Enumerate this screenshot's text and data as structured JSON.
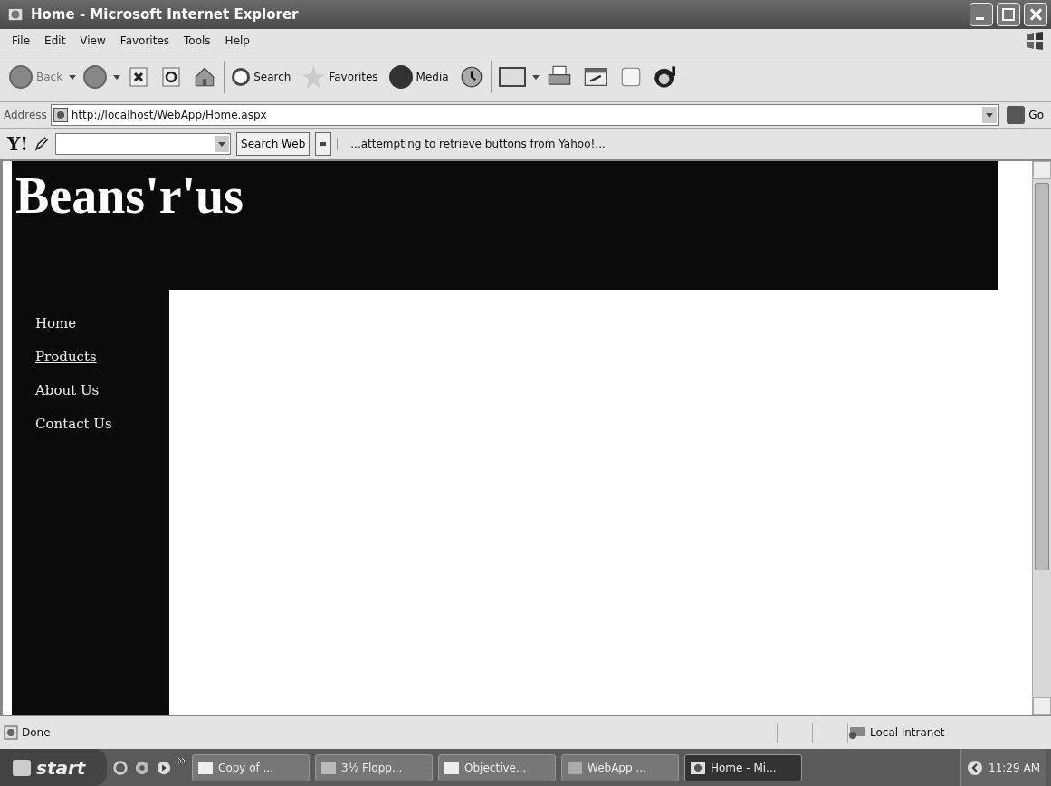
{
  "window": {
    "title": "Home - Microsoft Internet Explorer"
  },
  "menu": [
    "File",
    "Edit",
    "View",
    "Favorites",
    "Tools",
    "Help"
  ],
  "toolbar": [
    {
      "kind": "back",
      "label": "Back"
    },
    {
      "kind": "forward"
    },
    {
      "kind": "stop"
    },
    {
      "kind": "refresh"
    },
    {
      "kind": "home"
    },
    {
      "kind": "search",
      "label": "Search"
    },
    {
      "kind": "favorites",
      "label": "Favorites"
    },
    {
      "kind": "media",
      "label": "Media"
    },
    {
      "kind": "history"
    },
    {
      "kind": "mail"
    },
    {
      "kind": "print"
    },
    {
      "kind": "edit"
    },
    {
      "kind": "blank"
    },
    {
      "kind": "messenger"
    }
  ],
  "address": {
    "label": "Address",
    "url": "http://localhost/WebApp/Home.aspx",
    "go": "Go"
  },
  "yahoo_bar": {
    "logo": "Y!",
    "search_button": "Search Web",
    "message": "...attempting to retrieve buttons from Yahoo!..."
  },
  "page": {
    "site_title": "Beans'r'us",
    "nav": [
      {
        "label": "Home",
        "hovered": false
      },
      {
        "label": "Products",
        "hovered": true
      },
      {
        "label": "About Us",
        "hovered": false
      },
      {
        "label": "Contact Us",
        "hovered": false
      }
    ]
  },
  "status_bar": {
    "text": "Done",
    "zone": "Local intranet"
  },
  "taskbar": {
    "start": "start",
    "tasks": [
      {
        "label": "Copy of ...",
        "kind": "word",
        "selected": false
      },
      {
        "label": "3½ Flopp...",
        "kind": "drive",
        "selected": false
      },
      {
        "label": "Objective...",
        "kind": "word",
        "selected": false
      },
      {
        "label": "WebApp ...",
        "kind": "folder",
        "selected": false
      },
      {
        "label": "Home - Mi...",
        "kind": "ie",
        "selected": true
      }
    ],
    "clock": "11:29 AM"
  }
}
